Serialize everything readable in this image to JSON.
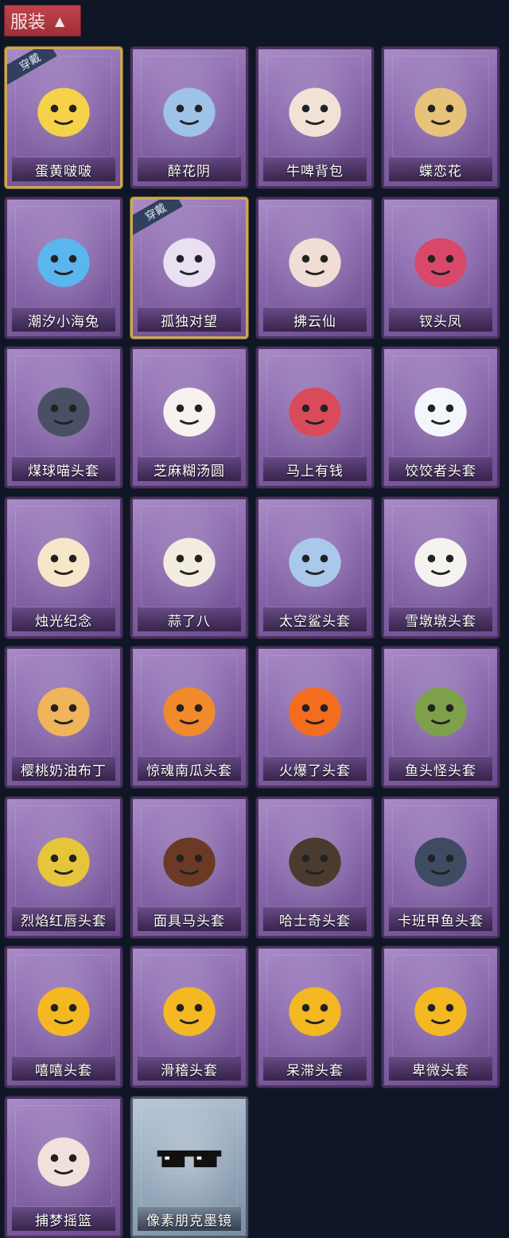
{
  "header": {
    "title": "服装",
    "chevron_icon": "chevron-up-icon"
  },
  "worn_badge": "穿戴",
  "items": [
    {
      "name": "蛋黄啵啵",
      "worn": true,
      "icon": "egg-chick-icon"
    },
    {
      "name": "醉花阴",
      "worn": false,
      "icon": "dreamcatcher-icon"
    },
    {
      "name": "牛啤背包",
      "worn": false,
      "icon": "cow-mug-icon"
    },
    {
      "name": "蝶恋花",
      "worn": false,
      "icon": "bell-ornament-icon"
    },
    {
      "name": "潮汐小海兔",
      "worn": false,
      "icon": "sea-bunny-icon"
    },
    {
      "name": "孤独对望",
      "worn": true,
      "icon": "doll-charm-icon"
    },
    {
      "name": "拂云仙",
      "worn": false,
      "icon": "fairy-charm-icon"
    },
    {
      "name": "钗头凤",
      "worn": false,
      "icon": "phoenix-crown-icon"
    },
    {
      "name": "煤球喵头套",
      "worn": false,
      "icon": "cat-head-icon"
    },
    {
      "name": "芝麻糊汤圆",
      "worn": false,
      "icon": "dumpling-icon"
    },
    {
      "name": "马上有钱",
      "worn": false,
      "icon": "horse-head-icon"
    },
    {
      "name": "饺饺者头套",
      "worn": false,
      "icon": "cloud-dumpling-icon"
    },
    {
      "name": "烛光纪念",
      "worn": false,
      "icon": "candle-icon"
    },
    {
      "name": "蒜了八",
      "worn": false,
      "icon": "garlic-icon"
    },
    {
      "name": "太空鲨头套",
      "worn": false,
      "icon": "shark-head-icon"
    },
    {
      "name": "雪墩墩头套",
      "worn": false,
      "icon": "snowman-head-icon"
    },
    {
      "name": "樱桃奶油布丁",
      "worn": false,
      "icon": "pudding-icon"
    },
    {
      "name": "惊魂南瓜头套",
      "worn": false,
      "icon": "pumpkin-icon"
    },
    {
      "name": "火爆了头套",
      "worn": false,
      "icon": "fire-head-icon"
    },
    {
      "name": "鱼头怪头套",
      "worn": false,
      "icon": "fish-mask-icon"
    },
    {
      "name": "烈焰红唇头套",
      "worn": false,
      "icon": "pikachu-mask-icon"
    },
    {
      "name": "面具马头套",
      "worn": false,
      "icon": "horse-mask-icon"
    },
    {
      "name": "哈士奇头套",
      "worn": false,
      "icon": "husky-mask-icon"
    },
    {
      "name": "卡班甲鱼头套",
      "worn": false,
      "icon": "turtle-head-icon"
    },
    {
      "name": "嘻嘻头套",
      "worn": false,
      "icon": "grin-emoji-icon"
    },
    {
      "name": "滑稽头套",
      "worn": false,
      "icon": "smirk-emoji-icon"
    },
    {
      "name": "呆滞头套",
      "worn": false,
      "icon": "stare-emoji-icon"
    },
    {
      "name": "卑微头套",
      "worn": false,
      "icon": "humble-emoji-icon"
    },
    {
      "name": "捕梦摇篮",
      "worn": false,
      "icon": "dream-head-icon"
    },
    {
      "name": "像素朋克墨镜",
      "worn": false,
      "icon": "pixel-sunglasses-icon",
      "grey": true
    }
  ]
}
